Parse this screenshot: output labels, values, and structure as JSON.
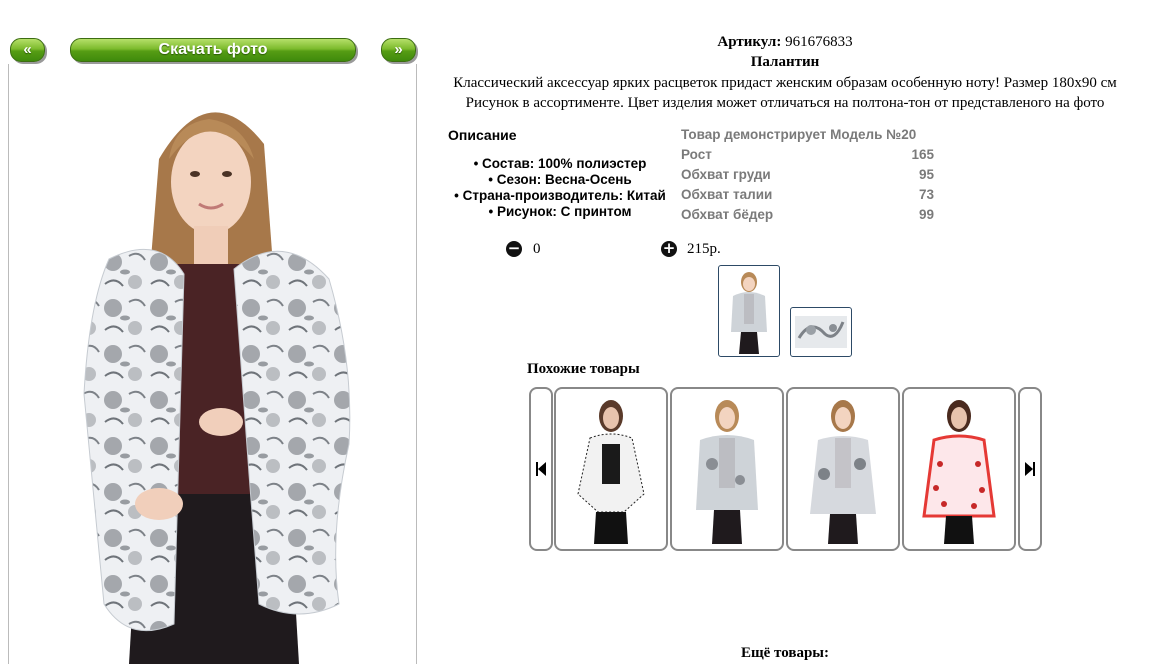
{
  "nav": {
    "prev_label": "«",
    "download_label": "Скачать фото",
    "next_label": "»"
  },
  "product": {
    "sku_label": "Артикул:",
    "sku_value": "961676833",
    "title": "Палантин",
    "description_line1": "Классический аксессуар ярких расцветок придаст женским образам особенную ноту! Размер 180х90 см",
    "description_line2": "Рисунок в ассортименте. Цвет изделия может отличаться на полтона-тон от представленого на фото"
  },
  "details": {
    "heading": "Описание",
    "attributes": [
      "Состав: 100% полиэстер",
      "Сезон: Весна-Осень",
      "Страна-производитель: Китай",
      "Рисунок: С принтом"
    ]
  },
  "model": {
    "heading": "Товар демонстрирует Модель №20",
    "rows": [
      {
        "label": "Рост",
        "value": "165"
      },
      {
        "label": "Обхват груди",
        "value": "95"
      },
      {
        "label": "Обхват талии",
        "value": "73"
      },
      {
        "label": "Обхват бёдер",
        "value": "99"
      }
    ]
  },
  "cart": {
    "quantity": "0",
    "price": "215р."
  },
  "icons": {
    "minus": "minus-circle-icon",
    "plus": "plus-circle-icon",
    "carousel_prev": "skip-back-icon",
    "carousel_next": "skip-forward-icon"
  },
  "similar": {
    "heading": "Похожие товары"
  },
  "more": {
    "heading": "Ещё товары:"
  },
  "colors": {
    "button_green": "#569d14",
    "thumb_border": "#2d4a66",
    "model_text": "#7a7a7a"
  }
}
